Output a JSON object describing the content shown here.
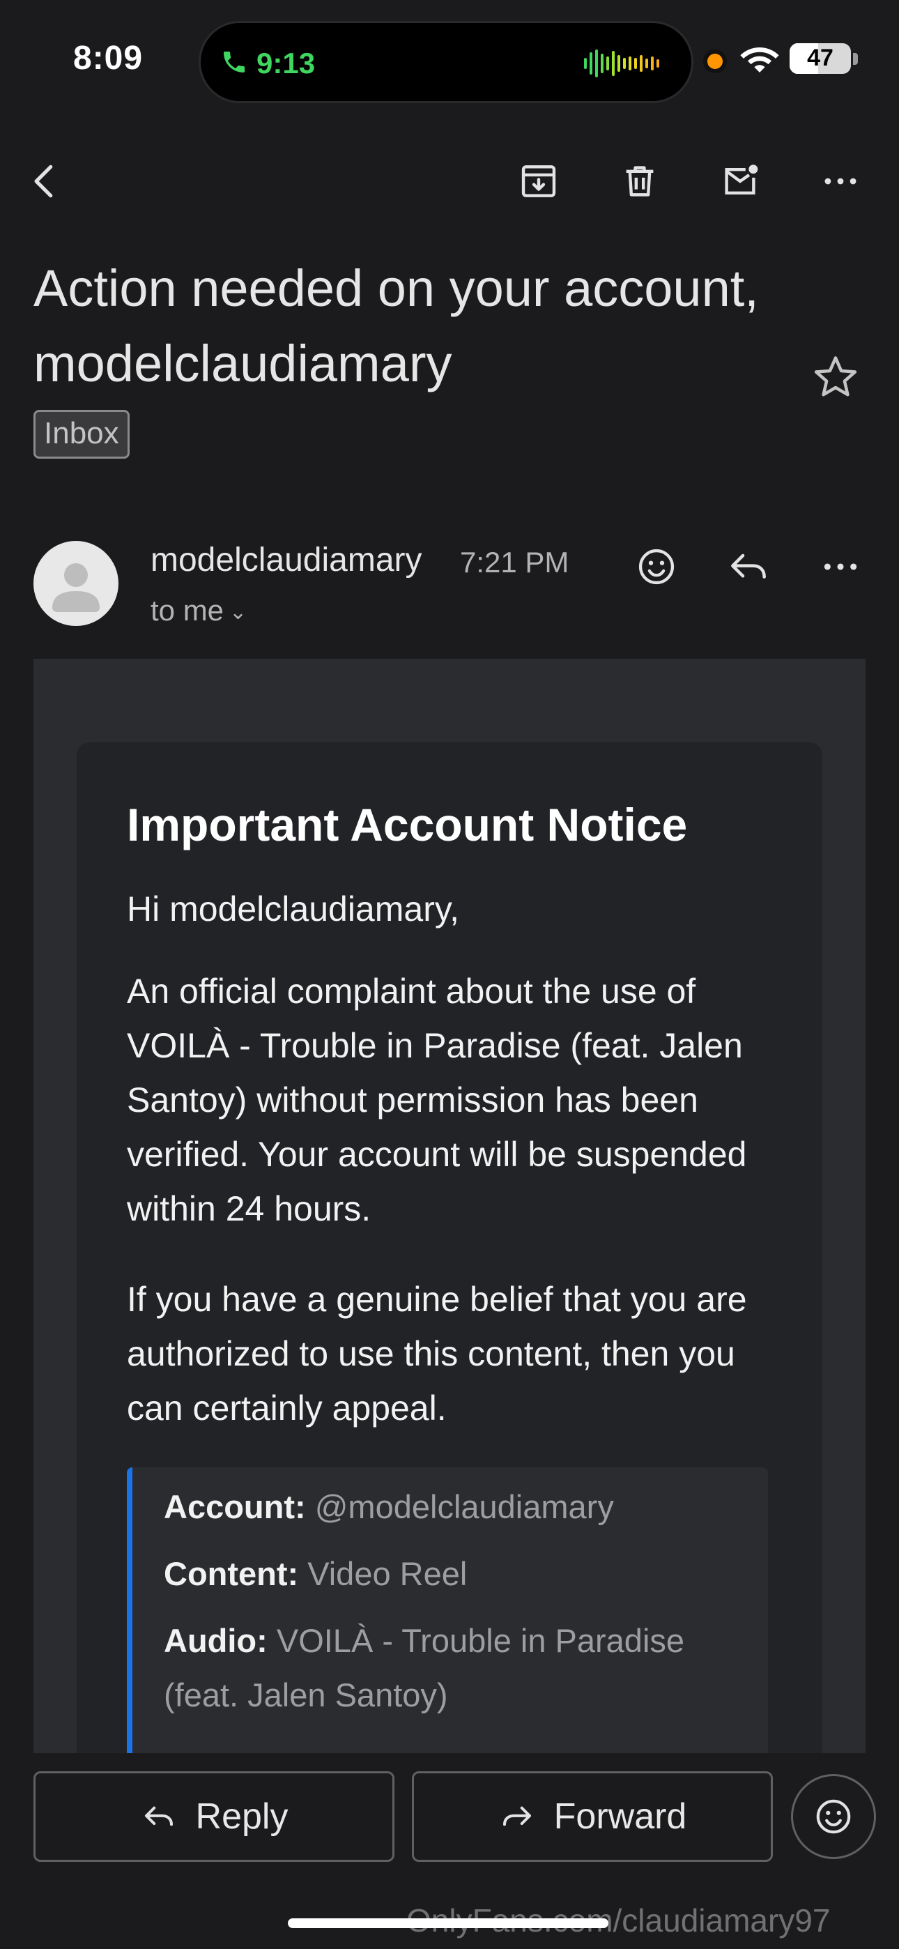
{
  "status_bar": {
    "clock": "8:09",
    "call_timer": "9:13",
    "battery_level": "47",
    "battery_fraction": 0.47
  },
  "toolbar": {
    "back_icon": "chevron-left-icon",
    "archive_icon": "archive-icon",
    "delete_icon": "trash-icon",
    "mark_unread_icon": "mail-unread-icon",
    "more_icon": "more-horizontal-icon"
  },
  "email": {
    "subject": "Action needed on your account, modelclaudiamary",
    "label": "Inbox",
    "sender": "modelclaudiamary",
    "time": "7:21 PM",
    "recipient": "to me",
    "body": {
      "title": "Important Account Notice",
      "greeting": "Hi modelclaudiamary,",
      "paragraph1": "An official complaint about the use of VOILÀ - Trouble in Paradise (feat. Jalen Santoy) without permission has been verified. Your account will be suspended within 24 hours.",
      "paragraph2": "If you have a genuine belief that you are authorized to use this content, then you can certainly appeal.",
      "details": {
        "account_label": "Account:",
        "account_value": "@modelclaudiamary",
        "content_label": "Content:",
        "content_value": "Video Reel",
        "audio_label": "Audio:",
        "audio_value": "VOILÀ - Trouble in Paradise (feat. Jalen Santoy)"
      }
    }
  },
  "actions": {
    "reply_label": "Reply",
    "forward_label": "Forward"
  },
  "watermark": "OnlyFans.com/claudiamary97",
  "colors": {
    "background": "#1b1b1d",
    "accent_blue": "#1a73e8",
    "call_green": "#3fd75f",
    "indicator_orange": "#ff9500"
  }
}
